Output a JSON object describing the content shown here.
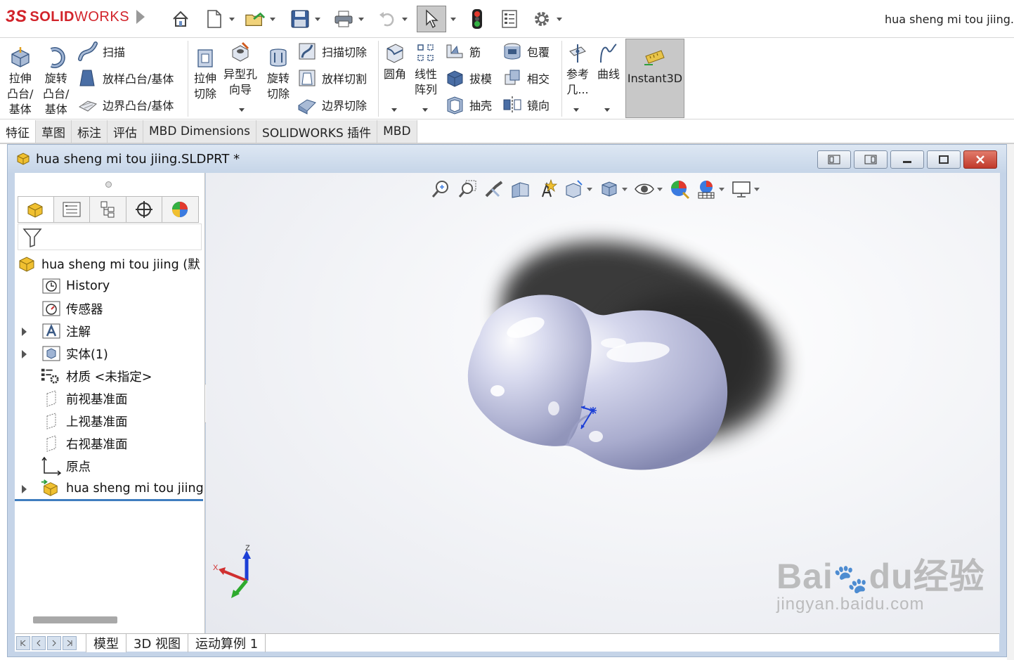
{
  "app": {
    "logo_ds": "3S",
    "logo_solid": "SOLID",
    "logo_works": "WORKS",
    "document_title": "hua sheng mi tou  jiing."
  },
  "ribbon": {
    "extrude_boss": "拉伸\n凸台/\n基体",
    "revolve_boss": "旋转\n凸台/\n基体",
    "sweep": "扫描",
    "loft_boss": "放样凸台/基体",
    "boundary_boss": "边界凸台/基体",
    "extrude_cut": "拉伸\n切除",
    "hole_wizard": "异型孔\n向导",
    "revolve_cut": "旋转\n切除",
    "swept_cut": "扫描切除",
    "lofted_cut": "放样切割",
    "boundary_cut": "边界切除",
    "fillet": "圆角",
    "linear_pattern": "线性\n阵列",
    "rib": "筋",
    "draft": "拔模",
    "shell": "抽壳",
    "wrap": "包覆",
    "intersect": "相交",
    "mirror": "镜向",
    "ref_geometry": "参考\n几...",
    "curves": "曲线",
    "instant3d": "Instant3D"
  },
  "tabs": [
    {
      "label": "特征"
    },
    {
      "label": "草图"
    },
    {
      "label": "标注"
    },
    {
      "label": "评估"
    },
    {
      "label": "MBD Dimensions"
    },
    {
      "label": "SOLIDWORKS 插件"
    },
    {
      "label": "MBD"
    }
  ],
  "document": {
    "title": "hua sheng mi tou  jiing.SLDPRT *"
  },
  "tree": {
    "root": "hua sheng mi tou  jiing  (默",
    "items": [
      {
        "label": "History"
      },
      {
        "label": "传感器"
      },
      {
        "label": "注解"
      },
      {
        "label": "实体(1)"
      },
      {
        "label": "材质 <未指定>"
      },
      {
        "label": "前视基准面"
      },
      {
        "label": "上视基准面"
      },
      {
        "label": "右视基准面"
      },
      {
        "label": "原点"
      },
      {
        "label": "hua sheng mi tou  jiing"
      }
    ]
  },
  "triad": {
    "x": "X",
    "z": "Z"
  },
  "bottom_tabs": [
    {
      "label": "模型"
    },
    {
      "label": "3D 视图"
    },
    {
      "label": "运动算例 1"
    }
  ],
  "watermark": {
    "brand": "Bai",
    "brand2": "du",
    "chinese": "经验",
    "url": "jingyan.baidu.com"
  },
  "colors": {
    "accent_red": "#d2232a",
    "tree_selection": "#3f7dbf",
    "instant3d_bg": "#c8c8c8",
    "model_surface": "#c9cbe6"
  }
}
